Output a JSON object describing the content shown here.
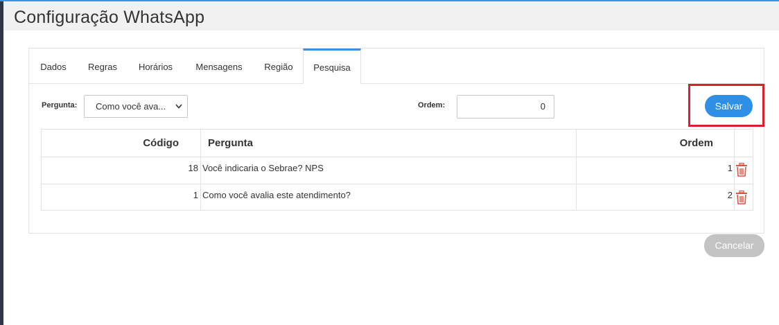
{
  "page": {
    "title": "Configuração WhatsApp"
  },
  "tabs": [
    {
      "label": "Dados",
      "active": false
    },
    {
      "label": "Regras",
      "active": false
    },
    {
      "label": "Horários",
      "active": false
    },
    {
      "label": "Mensagens",
      "active": false
    },
    {
      "label": "Região",
      "active": false
    },
    {
      "label": "Pesquisa",
      "active": true
    }
  ],
  "form": {
    "question_label": "Pergunta:",
    "question_selected": "Como você ava...",
    "order_label": "Ordem:",
    "order_value": "0",
    "save_label": "Salvar"
  },
  "table": {
    "headers": {
      "code": "Código",
      "question": "Pergunta",
      "order": "Ordem"
    },
    "rows": [
      {
        "code": "18",
        "question": "Você indicaria o Sebrae? NPS",
        "order": "1"
      },
      {
        "code": "1",
        "question": "Como você avalia este atendimento?",
        "order": "2"
      }
    ]
  },
  "footer": {
    "cancel_label": "Cancelar"
  },
  "colors": {
    "accent": "#2e8fe6",
    "highlight": "#d9202b",
    "delete": "#e0533f",
    "cancel_bg": "#c3c3c3"
  },
  "icons": {
    "delete": "trash-icon",
    "dropdown": "chevron-down-icon"
  }
}
